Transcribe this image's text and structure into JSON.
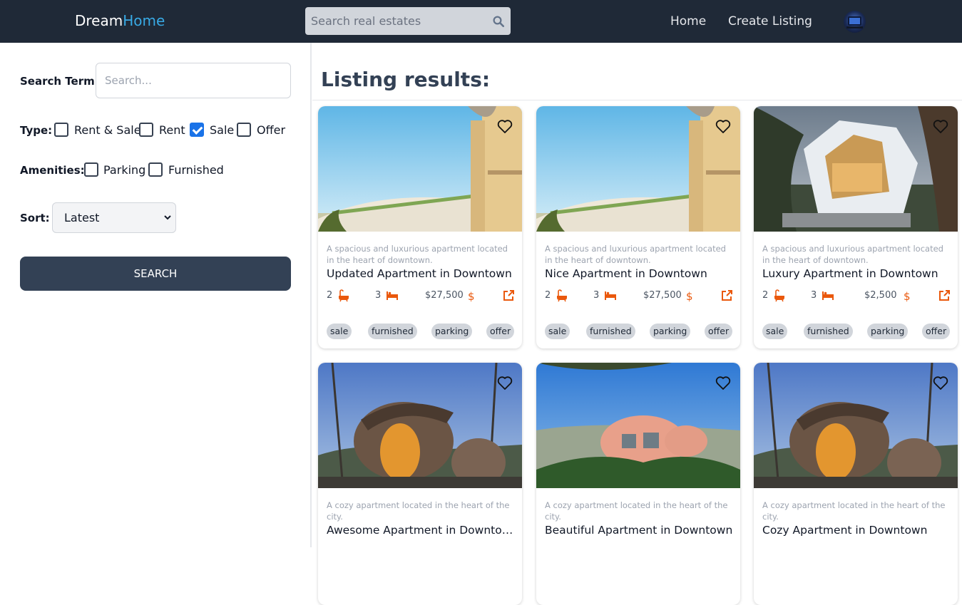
{
  "header": {
    "logo_part1": "Dream",
    "logo_part2": "Home",
    "search_placeholder": "Search real estates",
    "nav_home": "Home",
    "nav_create": "Create Listing"
  },
  "sidebar": {
    "search_term_label": "Search Term:",
    "search_term_placeholder": "Search...",
    "type_label": "Type:",
    "type_options": [
      {
        "label": "Rent & Sale",
        "checked": false
      },
      {
        "label": "Rent",
        "checked": false
      },
      {
        "label": "Sale",
        "checked": true
      },
      {
        "label": "Offer",
        "checked": false
      }
    ],
    "amenities_label": "Amenities:",
    "amenity_options": [
      {
        "label": "Parking",
        "checked": false
      },
      {
        "label": "Furnished",
        "checked": false
      }
    ],
    "sort_label": "Sort:",
    "sort_value": "Latest",
    "search_button": "SEARCH"
  },
  "main": {
    "title": "Listing results:"
  },
  "colors": {
    "header_bg": "#1f2937",
    "accent": "#38a9e4",
    "icon_orange": "#ea580c",
    "button_bg": "#334155"
  },
  "listings": [
    {
      "description": "A spacious and luxurious apartment located in the heart of downtown.",
      "title": "Updated Apartment in Downtown",
      "baths": "2",
      "beds": "3",
      "price": "$27,500",
      "tags": [
        "sale",
        "furnished",
        "parking",
        "offer"
      ],
      "image": "hotel-building"
    },
    {
      "description": "A spacious and luxurious apartment located in the heart of downtown.",
      "title": "Nice Apartment in Downtown",
      "baths": "2",
      "beds": "3",
      "price": "$27,500",
      "tags": [
        "sale",
        "furnished",
        "parking",
        "offer"
      ],
      "image": "hotel-building"
    },
    {
      "description": "A spacious and luxurious apartment located in the heart of downtown.",
      "title": "Luxury Apartment in Downtown",
      "baths": "2",
      "beds": "3",
      "price": "$2,500",
      "tags": [
        "sale",
        "furnished",
        "parking",
        "offer"
      ],
      "image": "modern-villa"
    },
    {
      "description": "A cozy apartment located in the heart of the city.",
      "title": "Awesome Apartment in Downtown",
      "baths": "",
      "beds": "",
      "price": "",
      "tags": [],
      "image": "treehouse"
    },
    {
      "description": "A cozy apartment located in the heart of the city.",
      "title": "Beautiful Apartment in Downtown",
      "baths": "",
      "beds": "",
      "price": "",
      "tags": [],
      "image": "dome-house"
    },
    {
      "description": "A cozy apartment located in the heart of the city.",
      "title": "Cozy Apartment in Downtown",
      "baths": "",
      "beds": "",
      "price": "",
      "tags": [],
      "image": "treehouse"
    }
  ]
}
